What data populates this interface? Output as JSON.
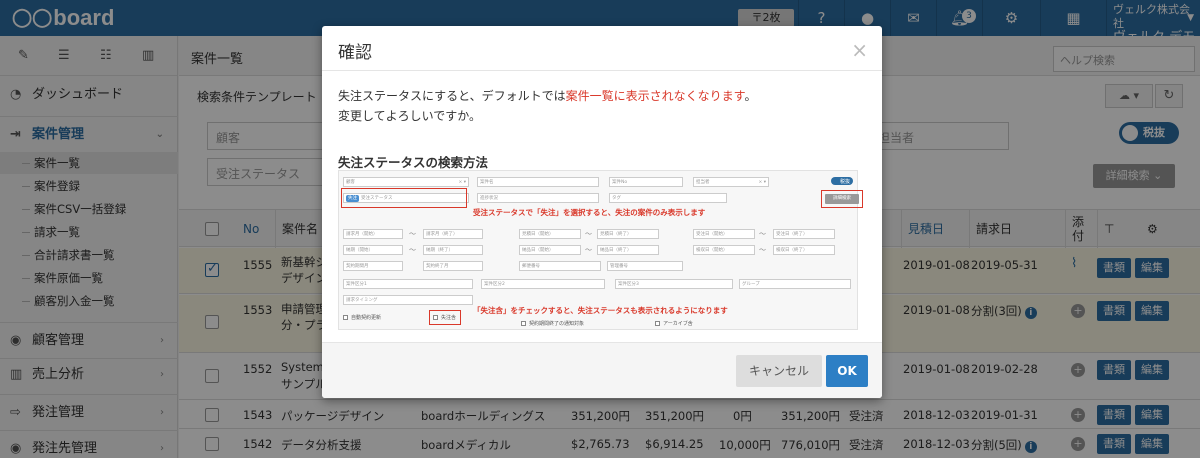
{
  "app": {
    "logo": "board",
    "pill": "〒2枚",
    "company_line": "ヴェルク株式会社",
    "user_name": "ヴェルク デモ",
    "notification_count": "3"
  },
  "sidebar": {
    "items": {
      "dashboard": "ダッシュボード",
      "projects": "案件管理",
      "customers": "顧客管理",
      "sales": "売上分析",
      "orders": "発注管理",
      "suppliers": "発注先管理"
    },
    "sub": [
      "案件一覧",
      "案件登録",
      "案件CSV一括登録",
      "請求一覧",
      "合計請求書一覧",
      "案件原価一覧",
      "顧客別入金一覧"
    ]
  },
  "main": {
    "title": "案件一覧",
    "help_placeholder": "ヘルプ検索",
    "template_label": "検索条件テンプレート",
    "customer_placeholder": "顧客",
    "status_placeholder": "受注ステータス",
    "owner_placeholder": "担当者",
    "tax_toggle": "税抜",
    "detail_search": "詳細検索"
  },
  "table": {
    "headers": {
      "no": "No",
      "name": "案件名",
      "estimate": "見積日",
      "invoice": "請求日",
      "attach": "添付"
    },
    "rows": [
      {
        "no": "1555",
        "name1": "新基幹シ",
        "name2": "デザイン",
        "estimate": "2019-01-08",
        "invoice": "2019-05-31",
        "checked": true
      },
      {
        "no": "1553",
        "name1": "申請管理",
        "name2": "分・プラ",
        "estimate": "2019-01-08",
        "invoice": "分割(3回)",
        "checked": false
      },
      {
        "no": "1552",
        "name1": "System",
        "name2": "サンプル",
        "estimate": "2019-01-08",
        "invoice": "2019-02-28",
        "checked": false
      },
      {
        "no": "1543",
        "name1": "パッケージデザイン",
        "customer": "boardホールディングス",
        "v1": "351,200円",
        "v2": "351,200円",
        "v3": "0円",
        "v4": "351,200円",
        "status": "受注済",
        "estimate": "2018-12-03",
        "invoice": "2019-01-31",
        "checked": false
      },
      {
        "no": "1542",
        "name1": "データ分析支援",
        "customer": "boardメディカル",
        "v1": "$2,765.73",
        "v2": "$6,914.25",
        "v3": "10,000円",
        "v4": "776,010円",
        "status": "受注済",
        "estimate": "2018-12-03",
        "invoice": "分割(5回)",
        "checked": false
      }
    ],
    "btn_doc": "書類",
    "btn_edit": "編集"
  },
  "modal": {
    "title": "確認",
    "msg_pre": "失注ステータスにすると、デフォルトでは",
    "msg_red": "案件一覧に表示されなくなります",
    "msg_post": "。",
    "msg_line2": "変更してよろしいですか。",
    "subtitle": "失注ステータスの検索方法",
    "cancel": "キャンセル",
    "ok": "OK",
    "illus": {
      "customer": "顧客",
      "tag": "失注",
      "status": "受注ステータス",
      "project_name": "案件名",
      "project_no": "案件No",
      "owner": "担当者",
      "tax": "税抜",
      "progress": "進捗状況",
      "tag_field": "タグ",
      "detail": "詳細検索",
      "note1": "受注ステータスで「失注」を選択すると、失注の案件のみ表示します",
      "note2": "「失注含」をチェックすると、失注ステータスも表示されるようになります",
      "f_req_s": "請求月（開始）",
      "f_req_e": "請求月（終了）",
      "f_est_s": "見積日（開始）",
      "f_est_e": "見積日（終了）",
      "f_ord_s": "受注日（開始）",
      "f_ord_e": "受注日（終了）",
      "f_due_s": "納期（開始）",
      "f_due_e": "納期（終了）",
      "f_dlv_s": "納品日（開始）",
      "f_dlv_e": "納品日（終了）",
      "f_inv_s": "検収日（開始）",
      "f_inv_e": "検収日（終了）",
      "f_con_s": "契約期間月",
      "f_con_e": "契約終了月",
      "zip": "郵便番号",
      "mgmt": "管理番号",
      "cat1": "案件区分1",
      "cat2": "案件区分2",
      "cat3": "案件区分3",
      "group": "グループ",
      "timing": "請求タイミング",
      "auto_renew": "自動契約更新",
      "lost_incl": "失注含",
      "contract_end": "契約期間終了の通知対象",
      "archive": "アーカイブ含"
    }
  }
}
